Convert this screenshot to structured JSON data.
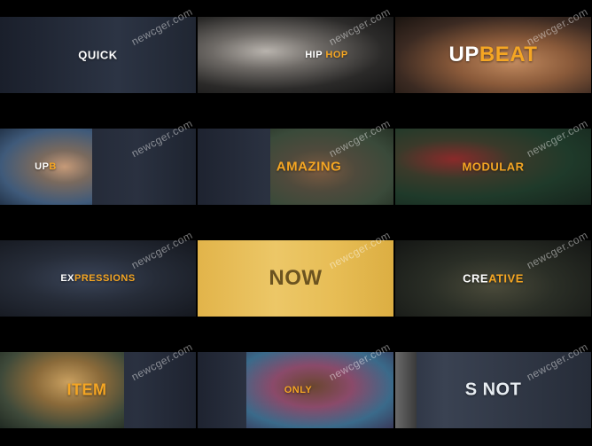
{
  "watermark": "newcger.com",
  "colors": {
    "accent": "#f5a623",
    "white": "#ffffff",
    "band_dark": "#1e2330",
    "yellow_band": "#e8c059"
  },
  "tiles": [
    {
      "a": "QUICK",
      "b": ""
    },
    {
      "a": "HIP ",
      "b": "HOP"
    },
    {
      "a": "UP",
      "b": "BEAT"
    },
    {
      "a": "UP",
      "b": "B"
    },
    {
      "a": "",
      "b": "AMAZING"
    },
    {
      "a": "",
      "b": "MODULAR"
    },
    {
      "a": "EX",
      "b": "PRESSIONS"
    },
    {
      "a": "NOW",
      "b": ""
    },
    {
      "a": "CRE",
      "b": "ATIVE"
    },
    {
      "a": "",
      "b": "ITEM"
    },
    {
      "a": "",
      "b": "ONLY"
    },
    {
      "a": "S NOT",
      "b": ""
    }
  ]
}
